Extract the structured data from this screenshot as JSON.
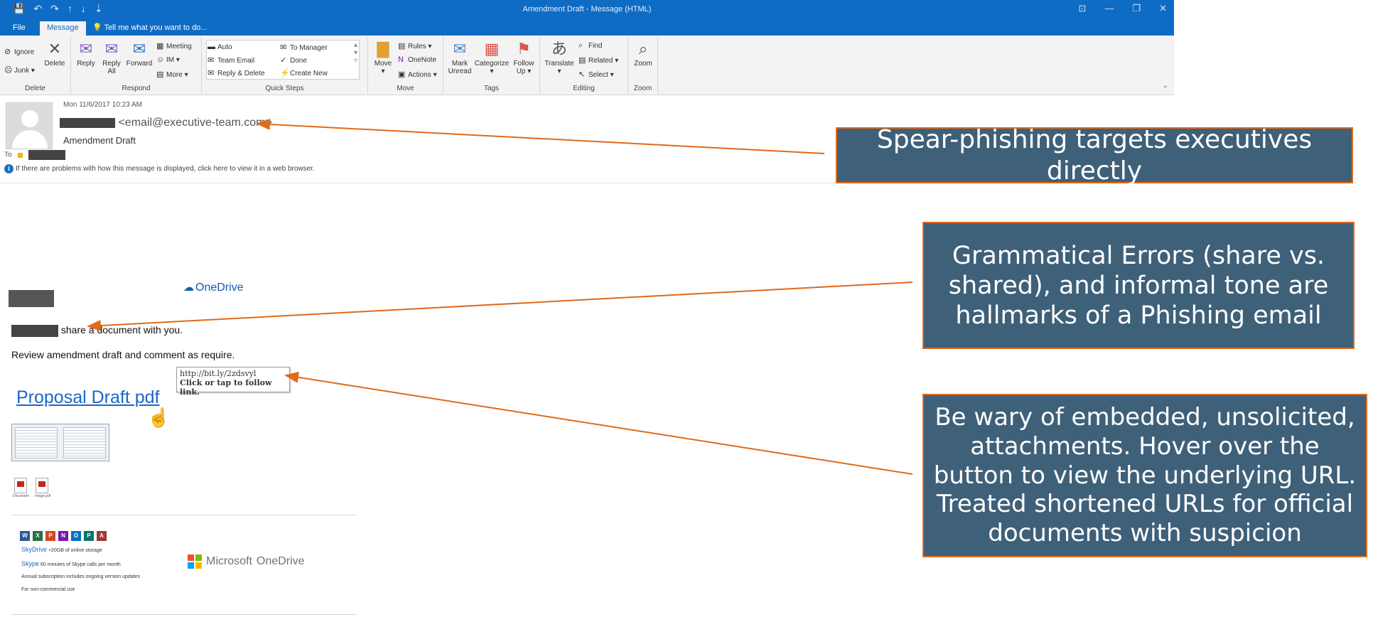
{
  "window": {
    "title": "Amendment Draft  -  Message (HTML)",
    "window_controls": [
      "⊡",
      "—",
      "❐",
      "✕"
    ]
  },
  "menu": {
    "file": "File",
    "message": "Message",
    "tell_me": "Tell me what you want to do..."
  },
  "ribbon": {
    "delete_group": {
      "label": "Delete",
      "ignore": "Ignore",
      "junk": "Junk",
      "delete": "Delete"
    },
    "respond_group": {
      "label": "Respond",
      "reply": "Reply",
      "reply_all_line1": "Reply",
      "reply_all_line2": "All",
      "forward": "Forward",
      "meeting": "Meeting",
      "im": "IM",
      "more": "More"
    },
    "quick_steps_group": {
      "label": "Quick Steps",
      "auto": "Auto",
      "to_manager": "To Manager",
      "team_email": "Team Email",
      "done": "Done",
      "reply_delete": "Reply & Delete",
      "create_new": "Create New"
    },
    "move_group": {
      "label": "Move",
      "move": "Move",
      "rules": "Rules",
      "onenote": "OneNote",
      "actions": "Actions"
    },
    "tags_group": {
      "label": "Tags",
      "mark_unread_line1": "Mark",
      "mark_unread_line2": "Unread",
      "categorize": "Categorize",
      "follow_up_line1": "Follow",
      "follow_up_line2": "Up"
    },
    "editing_group": {
      "label": "Editing",
      "translate": "Translate",
      "find": "Find",
      "related": "Related",
      "select": "Select"
    },
    "zoom_group": {
      "label": "Zoom",
      "zoom": "Zoom"
    }
  },
  "header": {
    "date": "Mon 11/6/2017 10:23 AM",
    "from_email": "<email@executive-team.com>",
    "subject": "Amendment Draft",
    "to_label": "To",
    "info_text": "If there are problems with how this message is displayed, click here to view it in a web browser."
  },
  "body": {
    "onedrive_logo": "OneDrive",
    "share_line": "share a document with you.",
    "review_line": "Review amendment draft and comment as require.",
    "link_text": "Proposal Draft pdf",
    "tooltip_url": "http://bit.ly/2zdsvyl",
    "tooltip_hint": "Click or tap to follow link.",
    "pdf_labels": [
      "Document",
      "Image.pdf"
    ],
    "office_icons": [
      {
        "letter": "W",
        "color": "#2b579a"
      },
      {
        "letter": "X",
        "color": "#217346"
      },
      {
        "letter": "P",
        "color": "#d24726"
      },
      {
        "letter": "N",
        "color": "#7719aa"
      },
      {
        "letter": "O",
        "color": "#0072c6"
      },
      {
        "letter": "P",
        "color": "#077568"
      },
      {
        "letter": "A",
        "color": "#a4373a"
      }
    ],
    "ad_skydrive_brand": "SkyDrive",
    "ad_skydrive_text": "+20GB of online storage",
    "ad_skype_brand": "Skype",
    "ad_skype_text": "60 minutes of Skype calls per month",
    "ad_subscription": "Annual subscription includes ongoing version updates",
    "ad_noncommercial": "For non-commercial use",
    "ms_brand": "Microsoft",
    "ms_product": "OneDrive"
  },
  "annotations": {
    "spear_phishing": "Spear-phishing targets executives directly",
    "grammar": "Grammatical Errors (share vs. shared), and informal tone are hallmarks of a Phishing email",
    "attachments": "Be wary of embedded, unsolicited, attachments. Hover over the button to view the underlying URL. Treated shortened URLs for official documents with suspicion"
  },
  "colors": {
    "title_bar": "#0f6cc4",
    "callout_bg": "#3f6079",
    "callout_border": "#e06a1a",
    "arrow": "#e06a1a",
    "link": "#1a67c6"
  }
}
